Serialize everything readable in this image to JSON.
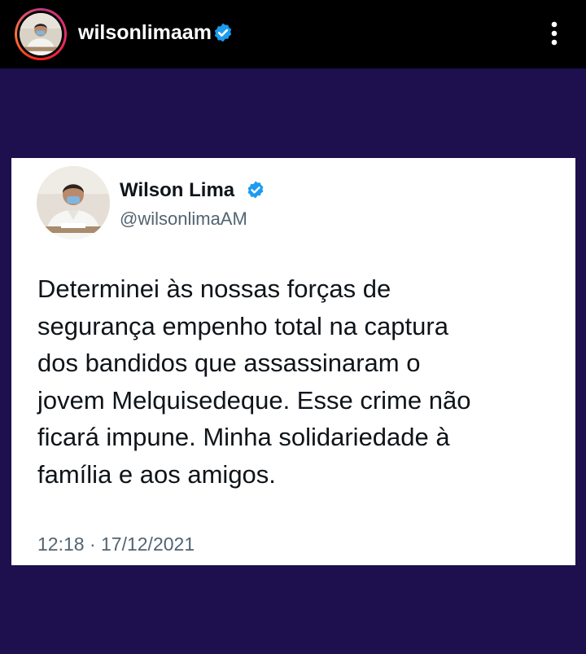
{
  "header": {
    "username": "wilsonlimaam",
    "verified_icon": "verified-badge-icon",
    "menu_icon": "more-vertical-icon"
  },
  "tweet": {
    "display_name": "Wilson Lima",
    "handle": "@wilsonlimaAM",
    "text": "Determinei às nossas forças de\nsegurança empenho total na captura\ndos bandidos que assassinaram o\njovem Melquisedeque. Esse crime não\nficará impune. Minha solidariedade à\nfamília e aos amigos.",
    "timestamp": "12:18 · 17/12/2021"
  },
  "colors": {
    "background": "#1e0f4f",
    "topbar": "#000000",
    "verified_blue": "#1d9bf0",
    "text_primary": "#0f1419",
    "text_secondary": "#536471"
  }
}
